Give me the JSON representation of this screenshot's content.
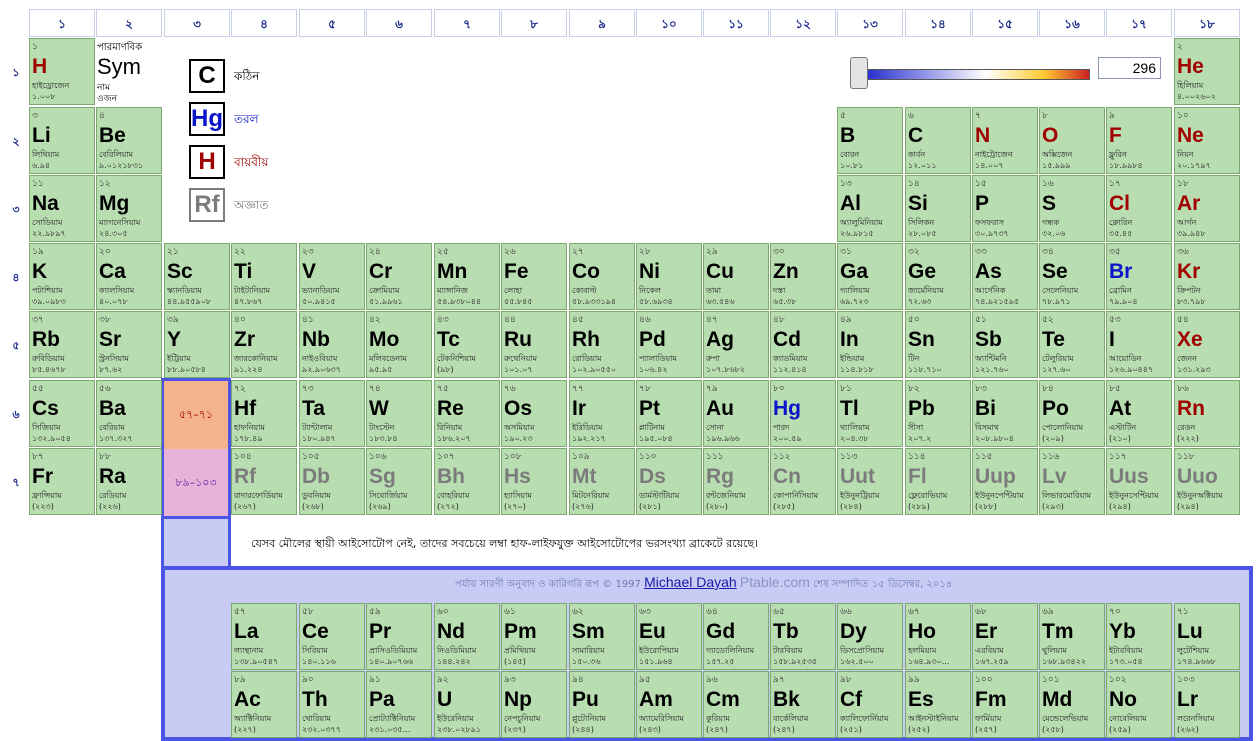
{
  "groups": [
    "১",
    "২",
    "৩",
    "৪",
    "৫",
    "৬",
    "৭",
    "৮",
    "৯",
    "১০",
    "১১",
    "১২",
    "১৩",
    "১৪",
    "১৫",
    "১৬",
    "১৭",
    "১৮"
  ],
  "periods": [
    "১",
    "২",
    "৩",
    "৪",
    "৫",
    "৬",
    "৭"
  ],
  "key": {
    "number": "পারমাণবিক",
    "symbol": "Sym",
    "name": "নাম",
    "mass": "ওজন"
  },
  "legend": [
    {
      "symbol": "C",
      "label": "কঠিন",
      "color": "#000000"
    },
    {
      "symbol": "Hg",
      "label": "তরল",
      "color": "#0a14c8"
    },
    {
      "symbol": "H",
      "label": "বায়বীয়",
      "color": "#a00000"
    },
    {
      "symbol": "Rf",
      "label": "অজ্ঞাত",
      "color": "#7b7b7b"
    }
  ],
  "temperature": {
    "value": "296"
  },
  "placeholders": {
    "lanthanides": "৫৭–৭১",
    "actinides": "৮৯–১০৩"
  },
  "note": "যেসব মৌলের স্থায়ী আইসোটোপ নেই, তাদের সবচেয়ে লম্বা হাফ-লাইফযুক্ত আইসোটোপের ভরসংখ্যা ব্রাকেটে রয়েছে।",
  "footer": {
    "prefix": "পর্যায় সারণী অনুবাদ ও কারিগরি রূপ © 1997",
    "author": "Michael Dayah",
    "site": "Ptable.com",
    "suffix": "শেষ সম্পাদিত ১৫ ডিসেম্বর, ২০১৪"
  },
  "colors": {
    "cell": "#b8ddb0",
    "lanthanide_placeholder": "#f4b38a",
    "actinide_placeholder": "#e8b3d8",
    "band": "#c8ccf4",
    "band_border": "#4a55e8"
  },
  "elements": [
    {
      "n": "১",
      "s": "H",
      "name": "হাইড্রোজেন",
      "m": "১.০০৮",
      "st": "gas",
      "g": 1,
      "p": 1
    },
    {
      "n": "২",
      "s": "He",
      "name": "হিলিয়াম",
      "m": "৪.০০২৬০২",
      "st": "gas",
      "g": 18,
      "p": 1
    },
    {
      "n": "৩",
      "s": "Li",
      "name": "লিথিয়াম",
      "m": "৬.৯৪",
      "st": "solid",
      "g": 1,
      "p": 2
    },
    {
      "n": "৪",
      "s": "Be",
      "name": "বেরিলিয়াম",
      "m": "৯.০১২১৮৩১",
      "st": "solid",
      "g": 2,
      "p": 2
    },
    {
      "n": "৫",
      "s": "B",
      "name": "বোরন",
      "m": "১০.৮১",
      "st": "solid",
      "g": 13,
      "p": 2
    },
    {
      "n": "৬",
      "s": "C",
      "name": "কার্বন",
      "m": "১২.০১১",
      "st": "solid",
      "g": 14,
      "p": 2
    },
    {
      "n": "৭",
      "s": "N",
      "name": "নাইট্রোজেন",
      "m": "১৪.০০৭",
      "st": "gas",
      "g": 15,
      "p": 2
    },
    {
      "n": "৮",
      "s": "O",
      "name": "অক্সিজেন",
      "m": "১৫.৯৯৯",
      "st": "gas",
      "g": 16,
      "p": 2
    },
    {
      "n": "৯",
      "s": "F",
      "name": "ফ্লুরিন",
      "m": "১৮.৯৯৮৪",
      "st": "gas",
      "g": 17,
      "p": 2
    },
    {
      "n": "১০",
      "s": "Ne",
      "name": "নিয়ন",
      "m": "২০.১৭৯৭",
      "st": "gas",
      "g": 18,
      "p": 2
    },
    {
      "n": "১১",
      "s": "Na",
      "name": "সোডিয়াম",
      "m": "২২.৯৮৯৭",
      "st": "solid",
      "g": 1,
      "p": 3
    },
    {
      "n": "১২",
      "s": "Mg",
      "name": "ম্যাগনেসিয়াম",
      "m": "২৪.৩০৫",
      "st": "solid",
      "g": 2,
      "p": 3
    },
    {
      "n": "১৩",
      "s": "Al",
      "name": "অ্যালুমিনিয়াম",
      "m": "২৬.৯৮১৫",
      "st": "solid",
      "g": 13,
      "p": 3
    },
    {
      "n": "১৪",
      "s": "Si",
      "name": "সিলিকন",
      "m": "২৮.০৮৫",
      "st": "solid",
      "g": 14,
      "p": 3
    },
    {
      "n": "১৫",
      "s": "P",
      "name": "ফসফরাস",
      "m": "৩০.৯৭৩৭",
      "st": "solid",
      "g": 15,
      "p": 3
    },
    {
      "n": "১৬",
      "s": "S",
      "name": "গন্ধক",
      "m": "৩২.০৬",
      "st": "solid",
      "g": 16,
      "p": 3
    },
    {
      "n": "১৭",
      "s": "Cl",
      "name": "ক্লোরিন",
      "m": "৩৫.৪৫",
      "st": "gas",
      "g": 17,
      "p": 3
    },
    {
      "n": "১৮",
      "s": "Ar",
      "name": "আর্গন",
      "m": "৩৯.৯৪৮",
      "st": "gas",
      "g": 18,
      "p": 3
    },
    {
      "n": "১৯",
      "s": "K",
      "name": "পটাশিয়াম",
      "m": "৩৯.০৯৮৩",
      "st": "solid",
      "g": 1,
      "p": 4
    },
    {
      "n": "২০",
      "s": "Ca",
      "name": "ক্যালসিয়াম",
      "m": "৪০.০৭৮",
      "st": "solid",
      "g": 2,
      "p": 4
    },
    {
      "n": "২১",
      "s": "Sc",
      "name": "স্ক্যানডিয়াম",
      "m": "৪৪.৯৫৫৯০৮",
      "st": "solid",
      "g": 3,
      "p": 4
    },
    {
      "n": "২২",
      "s": "Ti",
      "name": "টাইটানিয়াম",
      "m": "৪৭.৮৬৭",
      "st": "solid",
      "g": 4,
      "p": 4
    },
    {
      "n": "২৩",
      "s": "V",
      "name": "ভ্যানাডিয়াম",
      "m": "৫০.৯৪১৫",
      "st": "solid",
      "g": 5,
      "p": 4
    },
    {
      "n": "২৪",
      "s": "Cr",
      "name": "ক্রোমিয়াম",
      "m": "৫১.৯৯৬১",
      "st": "solid",
      "g": 6,
      "p": 4
    },
    {
      "n": "২৫",
      "s": "Mn",
      "name": "ম্যাঙ্গানিজ",
      "m": "৫৪.৯৩৮০৪৪",
      "st": "solid",
      "g": 7,
      "p": 4
    },
    {
      "n": "২৬",
      "s": "Fe",
      "name": "লোহা",
      "m": "৫৫.৮৪৫",
      "st": "solid",
      "g": 8,
      "p": 4
    },
    {
      "n": "২৭",
      "s": "Co",
      "name": "কোবাল্ট",
      "m": "৫৮.৯৩৩১৯৪",
      "st": "solid",
      "g": 9,
      "p": 4
    },
    {
      "n": "২৮",
      "s": "Ni",
      "name": "নিকেল",
      "m": "৫৮.৬৯৩৪",
      "st": "solid",
      "g": 10,
      "p": 4
    },
    {
      "n": "২৯",
      "s": "Cu",
      "name": "তামা",
      "m": "৬৩.৫৪৬",
      "st": "solid",
      "g": 11,
      "p": 4
    },
    {
      "n": "৩০",
      "s": "Zn",
      "name": "দস্তা",
      "m": "৬৫.৩৮",
      "st": "solid",
      "g": 12,
      "p": 4
    },
    {
      "n": "৩১",
      "s": "Ga",
      "name": "গ্যালিয়াম",
      "m": "৬৯.৭২৩",
      "st": "solid",
      "g": 13,
      "p": 4
    },
    {
      "n": "৩২",
      "s": "Ge",
      "name": "জার্মেনিয়াম",
      "m": "৭২.৬৩",
      "st": "solid",
      "g": 14,
      "p": 4
    },
    {
      "n": "৩৩",
      "s": "As",
      "name": "আর্সেনিক",
      "m": "৭৪.৯২১৫৯৫",
      "st": "solid",
      "g": 15,
      "p": 4
    },
    {
      "n": "৩৪",
      "s": "Se",
      "name": "সেলেনিয়াম",
      "m": "৭৮.৯৭১",
      "st": "solid",
      "g": 16,
      "p": 4
    },
    {
      "n": "৩৫",
      "s": "Br",
      "name": "ব্রোমিন",
      "m": "৭৯.৯০৪",
      "st": "liquid",
      "g": 17,
      "p": 4
    },
    {
      "n": "৩৬",
      "s": "Kr",
      "name": "ক্রিপটন",
      "m": "৮৩.৭৯৮",
      "st": "gas",
      "g": 18,
      "p": 4
    },
    {
      "n": "৩৭",
      "s": "Rb",
      "name": "রুবিডিয়াম",
      "m": "৮৫.৪৬৭৮",
      "st": "solid",
      "g": 1,
      "p": 5
    },
    {
      "n": "৩৮",
      "s": "Sr",
      "name": "স্ট্রনসিয়াম",
      "m": "৮৭.৬২",
      "st": "solid",
      "g": 2,
      "p": 5
    },
    {
      "n": "৩৯",
      "s": "Y",
      "name": "ইট্রিয়াম",
      "m": "৮৮.৯০৫৮৪",
      "st": "solid",
      "g": 3,
      "p": 5
    },
    {
      "n": "৪০",
      "s": "Zr",
      "name": "জারকোনিয়াম",
      "m": "৯১.২২৪",
      "st": "solid",
      "g": 4,
      "p": 5
    },
    {
      "n": "৪১",
      "s": "Nb",
      "name": "নাইওবিয়াম",
      "m": "৯২.৯০৬৩৭",
      "st": "solid",
      "g": 5,
      "p": 5
    },
    {
      "n": "৪২",
      "s": "Mo",
      "name": "মলিবডেনাম",
      "m": "৯৫.৯৫",
      "st": "solid",
      "g": 6,
      "p": 5
    },
    {
      "n": "৪৩",
      "s": "Tc",
      "name": "টেকনিশিয়াম",
      "m": "(৯৮)",
      "st": "solid",
      "g": 7,
      "p": 5
    },
    {
      "n": "৪৪",
      "s": "Ru",
      "name": "রুথেনিয়াম",
      "m": "১০১.০৭",
      "st": "solid",
      "g": 8,
      "p": 5
    },
    {
      "n": "৪৫",
      "s": "Rh",
      "name": "রোডিয়াম",
      "m": "১০২.৯০৫৫০",
      "st": "solid",
      "g": 9,
      "p": 5
    },
    {
      "n": "৪৬",
      "s": "Pd",
      "name": "প্যালাডিয়াম",
      "m": "১০৬.৪২",
      "st": "solid",
      "g": 10,
      "p": 5
    },
    {
      "n": "৪৭",
      "s": "Ag",
      "name": "রুপা",
      "m": "১০৭.৮৬৮২",
      "st": "solid",
      "g": 11,
      "p": 5
    },
    {
      "n": "৪৮",
      "s": "Cd",
      "name": "ক্যাডমিয়াম",
      "m": "১১২.৪১৪",
      "st": "solid",
      "g": 12,
      "p": 5
    },
    {
      "n": "৪৯",
      "s": "In",
      "name": "ইন্ডিয়াম",
      "m": "১১৪.৮১৮",
      "st": "solid",
      "g": 13,
      "p": 5
    },
    {
      "n": "৫০",
      "s": "Sn",
      "name": "টিন",
      "m": "১১৮.৭১০",
      "st": "solid",
      "g": 14,
      "p": 5
    },
    {
      "n": "৫১",
      "s": "Sb",
      "name": "অ্যান্টিমনি",
      "m": "১২১.৭৬০",
      "st": "solid",
      "g": 15,
      "p": 5
    },
    {
      "n": "৫২",
      "s": "Te",
      "name": "টেলুরিয়াম",
      "m": "১২৭.৬০",
      "st": "solid",
      "g": 16,
      "p": 5
    },
    {
      "n": "৫৩",
      "s": "I",
      "name": "আয়োডিন",
      "m": "১২৬.৯০৪৪৭",
      "st": "solid",
      "g": 17,
      "p": 5
    },
    {
      "n": "৫৪",
      "s": "Xe",
      "name": "জেনন",
      "m": "১৩১.২৯৩",
      "st": "gas",
      "g": 18,
      "p": 5
    },
    {
      "n": "৫৫",
      "s": "Cs",
      "name": "সিজিয়াম",
      "m": "১৩২.৯০৫৪",
      "st": "solid",
      "g": 1,
      "p": 6
    },
    {
      "n": "৫৬",
      "s": "Ba",
      "name": "বেরিয়াম",
      "m": "১৩৭.৩২৭",
      "st": "solid",
      "g": 2,
      "p": 6
    },
    {
      "n": "৭২",
      "s": "Hf",
      "name": "হাফনিয়াম",
      "m": "১৭৮.৪৯",
      "st": "solid",
      "g": 4,
      "p": 6
    },
    {
      "n": "৭৩",
      "s": "Ta",
      "name": "ট্যান্টালাম",
      "m": "১৮০.৯৪৭",
      "st": "solid",
      "g": 5,
      "p": 6
    },
    {
      "n": "৭৪",
      "s": "W",
      "name": "টাংস্টেন",
      "m": "১৮৩.৮৪",
      "st": "solid",
      "g": 6,
      "p": 6
    },
    {
      "n": "৭৫",
      "s": "Re",
      "name": "রিনিয়াম",
      "m": "১৮৬.২০৭",
      "st": "solid",
      "g": 7,
      "p": 6
    },
    {
      "n": "৭৬",
      "s": "Os",
      "name": "অসমিয়াম",
      "m": "১৯০.২৩",
      "st": "solid",
      "g": 8,
      "p": 6
    },
    {
      "n": "৭৭",
      "s": "Ir",
      "name": "ইরিডিয়াম",
      "m": "১৯২.২১৭",
      "st": "solid",
      "g": 9,
      "p": 6
    },
    {
      "n": "৭৮",
      "s": "Pt",
      "name": "প্লাটিনাম",
      "m": "১৯৫.০৮৪",
      "st": "solid",
      "g": 10,
      "p": 6
    },
    {
      "n": "৭৯",
      "s": "Au",
      "name": "সোনা",
      "m": "১৯৬.৯৬৬",
      "st": "solid",
      "g": 11,
      "p": 6
    },
    {
      "n": "৮০",
      "s": "Hg",
      "name": "পারদ",
      "m": "২০০.৫৯",
      "st": "liquid",
      "g": 12,
      "p": 6
    },
    {
      "n": "৮১",
      "s": "Tl",
      "name": "থ্যালিয়াম",
      "m": "২০৪.৩৮",
      "st": "solid",
      "g": 13,
      "p": 6
    },
    {
      "n": "৮২",
      "s": "Pb",
      "name": "সীসা",
      "m": "২০৭.২",
      "st": "solid",
      "g": 14,
      "p": 6
    },
    {
      "n": "৮৩",
      "s": "Bi",
      "name": "বিসমাথ",
      "m": "২০৮.৯৮০৪",
      "st": "solid",
      "g": 15,
      "p": 6
    },
    {
      "n": "৮৪",
      "s": "Po",
      "name": "পোলোনিয়াম",
      "m": "(২০৯)",
      "st": "solid",
      "g": 16,
      "p": 6
    },
    {
      "n": "৮৫",
      "s": "At",
      "name": "এস্টাটিন",
      "m": "(২১০)",
      "st": "solid",
      "g": 17,
      "p": 6
    },
    {
      "n": "৮৬",
      "s": "Rn",
      "name": "রেডন",
      "m": "(২২২)",
      "st": "gas",
      "g": 18,
      "p": 6
    },
    {
      "n": "৮৭",
      "s": "Fr",
      "name": "ফ্রান্সিয়াম",
      "m": "(২২৩)",
      "st": "solid",
      "g": 1,
      "p": 7
    },
    {
      "n": "৮৮",
      "s": "Ra",
      "name": "রেডিয়াম",
      "m": "(২২৬)",
      "st": "solid",
      "g": 2,
      "p": 7
    },
    {
      "n": "১০৪",
      "s": "Rf",
      "name": "রাদারফোর্ডিয়াম",
      "m": "(২৬৭)",
      "st": "unknown",
      "g": 4,
      "p": 7
    },
    {
      "n": "১০৫",
      "s": "Db",
      "name": "ডুবনিয়াম",
      "m": "(২৬৮)",
      "st": "unknown",
      "g": 5,
      "p": 7
    },
    {
      "n": "১০৬",
      "s": "Sg",
      "name": "সিবোর্জিয়াম",
      "m": "(২৬৯)",
      "st": "unknown",
      "g": 6,
      "p": 7
    },
    {
      "n": "১০৭",
      "s": "Bh",
      "name": "বোহরিয়াম",
      "m": "(২৭২)",
      "st": "unknown",
      "g": 7,
      "p": 7
    },
    {
      "n": "১০৮",
      "s": "Hs",
      "name": "হ্যাসিয়াম",
      "m": "(২৭০)",
      "st": "unknown",
      "g": 8,
      "p": 7
    },
    {
      "n": "১০৯",
      "s": "Mt",
      "name": "মিটনেরিয়াম",
      "m": "(২৭৬)",
      "st": "unknown",
      "g": 9,
      "p": 7
    },
    {
      "n": "১১০",
      "s": "Ds",
      "name": "ডার্মস্টাটিয়াম",
      "m": "(২৮১)",
      "st": "unknown",
      "g": 10,
      "p": 7
    },
    {
      "n": "১১১",
      "s": "Rg",
      "name": "রন্টজেনিয়াম",
      "m": "(২৮০)",
      "st": "unknown",
      "g": 11,
      "p": 7
    },
    {
      "n": "১১২",
      "s": "Cn",
      "name": "কোপার্নিসিয়াম",
      "m": "(২৮৫)",
      "st": "unknown",
      "g": 12,
      "p": 7
    },
    {
      "n": "১১৩",
      "s": "Uut",
      "name": "ইউনুনট্রিয়াম",
      "m": "(২৮৪)",
      "st": "unknown",
      "g": 13,
      "p": 7
    },
    {
      "n": "১১৪",
      "s": "Fl",
      "name": "ফ্লেরোভিয়াম",
      "m": "(২৮৯)",
      "st": "unknown",
      "g": 14,
      "p": 7
    },
    {
      "n": "১১৫",
      "s": "Uup",
      "name": "ইউনুনপেন্টিয়াম",
      "m": "(২৮৮)",
      "st": "unknown",
      "g": 15,
      "p": 7
    },
    {
      "n": "১১৬",
      "s": "Lv",
      "name": "লিভারমোরিয়াম",
      "m": "(২৯৩)",
      "st": "unknown",
      "g": 16,
      "p": 7
    },
    {
      "n": "১১৭",
      "s": "Uus",
      "name": "ইউনুনসেপ্টিয়াম",
      "m": "(২৯৪)",
      "st": "unknown",
      "g": 17,
      "p": 7
    },
    {
      "n": "১১৮",
      "s": "Uuo",
      "name": "ইউনুনঅক্টিয়াম",
      "m": "(২৯৪)",
      "st": "unknown",
      "g": 18,
      "p": 7
    },
    {
      "n": "৫৭",
      "s": "La",
      "name": "ল্যান্থানাম",
      "m": "১৩৮.৯০৫৪৭",
      "st": "solid",
      "g": 4,
      "p": 8
    },
    {
      "n": "৫৮",
      "s": "Ce",
      "name": "সিরিয়াম",
      "m": "১৪০.১১৬",
      "st": "solid",
      "g": 5,
      "p": 8
    },
    {
      "n": "৫৯",
      "s": "Pr",
      "name": "প্রাসিওডিমিয়াম",
      "m": "১৪০.৯০৭৬৬",
      "st": "solid",
      "g": 6,
      "p": 8
    },
    {
      "n": "৬০",
      "s": "Nd",
      "name": "নিওডিমিয়াম",
      "m": "১৪৪.২৪২",
      "st": "solid",
      "g": 7,
      "p": 8
    },
    {
      "n": "৬১",
      "s": "Pm",
      "name": "প্রমিথিয়াম",
      "m": "(১৪৫)",
      "st": "solid",
      "g": 8,
      "p": 8
    },
    {
      "n": "৬২",
      "s": "Sm",
      "name": "সামারিয়াম",
      "m": "১৫০.৩৬",
      "st": "solid",
      "g": 9,
      "p": 8
    },
    {
      "n": "৬৩",
      "s": "Eu",
      "name": "ইউরোপিয়াম",
      "m": "১৫১.৯৬৪",
      "st": "solid",
      "g": 10,
      "p": 8
    },
    {
      "n": "৬৪",
      "s": "Gd",
      "name": "গ্যাডোলিনিয়াম",
      "m": "১৫৭.২৫",
      "st": "solid",
      "g": 11,
      "p": 8
    },
    {
      "n": "৬৫",
      "s": "Tb",
      "name": "টারবিয়াম",
      "m": "১৫৮.৯২৫৩৫",
      "st": "solid",
      "g": 12,
      "p": 8
    },
    {
      "n": "৬৬",
      "s": "Dy",
      "name": "ডিসপ্রোসিয়াম",
      "m": "১৬২.৫০০",
      "st": "solid",
      "g": 13,
      "p": 8
    },
    {
      "n": "৬৭",
      "s": "Ho",
      "name": "হলমিয়াম",
      "m": "১৬৪.৯৩০...",
      "st": "solid",
      "g": 14,
      "p": 8
    },
    {
      "n": "৬৮",
      "s": "Er",
      "name": "এরবিয়াম",
      "m": "১৬৭.২৫৯",
      "st": "solid",
      "g": 15,
      "p": 8
    },
    {
      "n": "৬৯",
      "s": "Tm",
      "name": "থুলিয়াম",
      "m": "১৬৮.৯৩৪২২",
      "st": "solid",
      "g": 16,
      "p": 8
    },
    {
      "n": "৭০",
      "s": "Yb",
      "name": "ইটারবিয়াম",
      "m": "১৭৩.০৫৪",
      "st": "solid",
      "g": 17,
      "p": 8
    },
    {
      "n": "৭১",
      "s": "Lu",
      "name": "লুটেশিয়াম",
      "m": "১৭৪.৯৬৬৮",
      "st": "solid",
      "g": 18,
      "p": 8
    },
    {
      "n": "৮৯",
      "s": "Ac",
      "name": "অ্যাক্টিনিয়াম",
      "m": "(২২৭)",
      "st": "solid",
      "g": 4,
      "p": 9
    },
    {
      "n": "৯০",
      "s": "Th",
      "name": "থোরিয়াম",
      "m": "২৩২.০৩৭৭",
      "st": "solid",
      "g": 5,
      "p": 9
    },
    {
      "n": "৯১",
      "s": "Pa",
      "name": "প্রোট্যাক্টিনিয়াম",
      "m": "২৩১.০৩৫...",
      "st": "solid",
      "g": 6,
      "p": 9
    },
    {
      "n": "৯২",
      "s": "U",
      "name": "ইউরেনিয়াম",
      "m": "২৩৮.০২৮৯১",
      "st": "solid",
      "g": 7,
      "p": 9
    },
    {
      "n": "৯৩",
      "s": "Np",
      "name": "নেপচুনিয়াম",
      "m": "(২৩৭)",
      "st": "solid",
      "g": 8,
      "p": 9
    },
    {
      "n": "৯৪",
      "s": "Pu",
      "name": "প্লুটোনিয়াম",
      "m": "(২৪৪)",
      "st": "solid",
      "g": 9,
      "p": 9
    },
    {
      "n": "৯৫",
      "s": "Am",
      "name": "অ্যামেরিসিয়াম",
      "m": "(২৪৩)",
      "st": "solid",
      "g": 10,
      "p": 9
    },
    {
      "n": "৯৬",
      "s": "Cm",
      "name": "কুরিয়াম",
      "m": "(২৪৭)",
      "st": "solid",
      "g": 11,
      "p": 9
    },
    {
      "n": "৯৭",
      "s": "Bk",
      "name": "বার্কেলিয়াম",
      "m": "(২৪৭)",
      "st": "solid",
      "g": 12,
      "p": 9
    },
    {
      "n": "৯৮",
      "s": "Cf",
      "name": "ক্যালিফোর্নিয়াম",
      "m": "(২৫১)",
      "st": "solid",
      "g": 13,
      "p": 9
    },
    {
      "n": "৯৯",
      "s": "Es",
      "name": "আইনস্টাইনিয়াম",
      "m": "(২৫২)",
      "st": "solid",
      "g": 14,
      "p": 9
    },
    {
      "n": "১০০",
      "s": "Fm",
      "name": "ফার্মিয়াম",
      "m": "(২৫৭)",
      "st": "solid",
      "g": 15,
      "p": 9
    },
    {
      "n": "১০১",
      "s": "Md",
      "name": "মেন্ডেলেভিয়াম",
      "m": "(২৫৮)",
      "st": "solid",
      "g": 16,
      "p": 9
    },
    {
      "n": "১০২",
      "s": "No",
      "name": "নোবেলিয়াম",
      "m": "(২৫৯)",
      "st": "solid",
      "g": 17,
      "p": 9
    },
    {
      "n": "১০৩",
      "s": "Lr",
      "name": "লরেনসিয়াম",
      "m": "(২৬২)",
      "st": "solid",
      "g": 18,
      "p": 9
    }
  ]
}
